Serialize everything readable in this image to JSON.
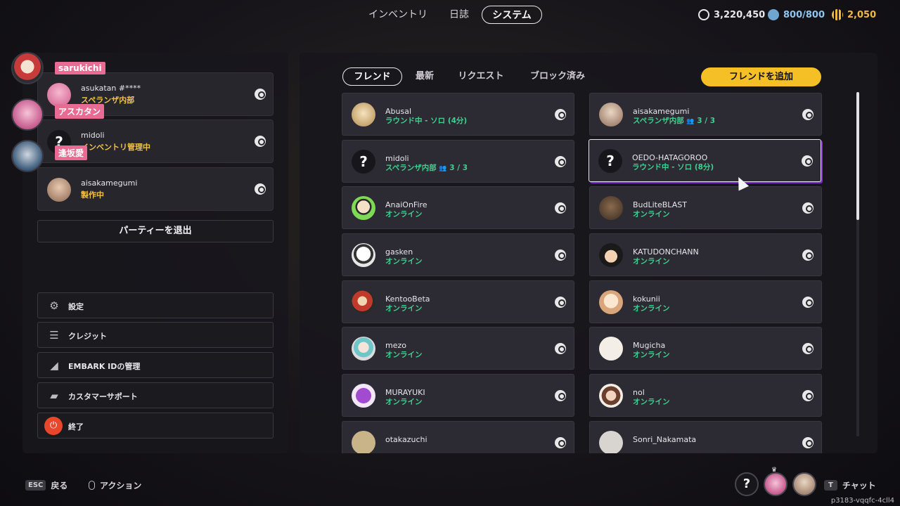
{
  "topnav": {
    "tabs": [
      {
        "label": "インベントリ",
        "active": false
      },
      {
        "label": "日誌",
        "active": false
      },
      {
        "label": "システム",
        "active": true
      }
    ],
    "currencies": [
      {
        "icon": "credits-icon",
        "value": "3,220,450",
        "color": "#e8e6ea"
      },
      {
        "icon": "storage-icon",
        "value": "800/800",
        "color": "#8fc6f0"
      },
      {
        "icon": "coins-icon",
        "value": "2,050",
        "color": "#f0b840"
      }
    ]
  },
  "party": {
    "tags": [
      "sarukichi",
      "アスカタン",
      "逢坂愛"
    ],
    "members": [
      {
        "name": "asukatan #****",
        "status": "スペランザ内部"
      },
      {
        "name": "midoli",
        "status": "インベントリ管理中"
      },
      {
        "name": "aisakamegumi",
        "status": "製作中"
      }
    ],
    "leave_label": "パーティーを退出"
  },
  "menu": [
    {
      "label": "設定",
      "icon": "gear-icon"
    },
    {
      "label": "クレジット",
      "icon": "list-icon"
    },
    {
      "label": "EMBARK IDの管理",
      "icon": "id-icon"
    },
    {
      "label": "カスタマーサポート",
      "icon": "chat-icon"
    },
    {
      "label": "終了",
      "icon": "power-icon"
    }
  ],
  "friends": {
    "tabs": [
      "フレンド",
      "最新",
      "リクエスト",
      "ブロック済み"
    ],
    "add_label": "フレンドを追加",
    "list": [
      {
        "name": "Abusal",
        "status": "ラウンド中 - ソロ (4分)"
      },
      {
        "name": "aisakamegumi",
        "status": "スペランザ内部",
        "count": "3 / 3"
      },
      {
        "name": "midoli",
        "status": "スペランザ内部",
        "count": "3 / 3"
      },
      {
        "name": "OEDO-HATAGOROO",
        "status": "ラウンド中 - ソロ (8分)"
      },
      {
        "name": "AnaiOnFire",
        "status": "オンライン"
      },
      {
        "name": "BudLiteBLAST",
        "status": "オンライン"
      },
      {
        "name": "gasken",
        "status": "オンライン"
      },
      {
        "name": "KATUDONCHANN",
        "status": "オンライン"
      },
      {
        "name": "KentooBeta",
        "status": "オンライン"
      },
      {
        "name": "kokunii",
        "status": "オンライン"
      },
      {
        "name": "mezo",
        "status": "オンライン"
      },
      {
        "name": "Mugicha",
        "status": "オンライン"
      },
      {
        "name": "MURAYUKI",
        "status": "オンライン"
      },
      {
        "name": "nol",
        "status": "オンライン"
      },
      {
        "name": "otakazuchi",
        "status": ""
      },
      {
        "name": "Sonri_Nakamata",
        "status": ""
      }
    ]
  },
  "bottom": {
    "esc_key": "ESC",
    "back_label": "戻る",
    "action_label": "アクション",
    "chat_key": "T",
    "chat_label": "チャット",
    "session": "p3183-vqqfc-4cll4"
  }
}
